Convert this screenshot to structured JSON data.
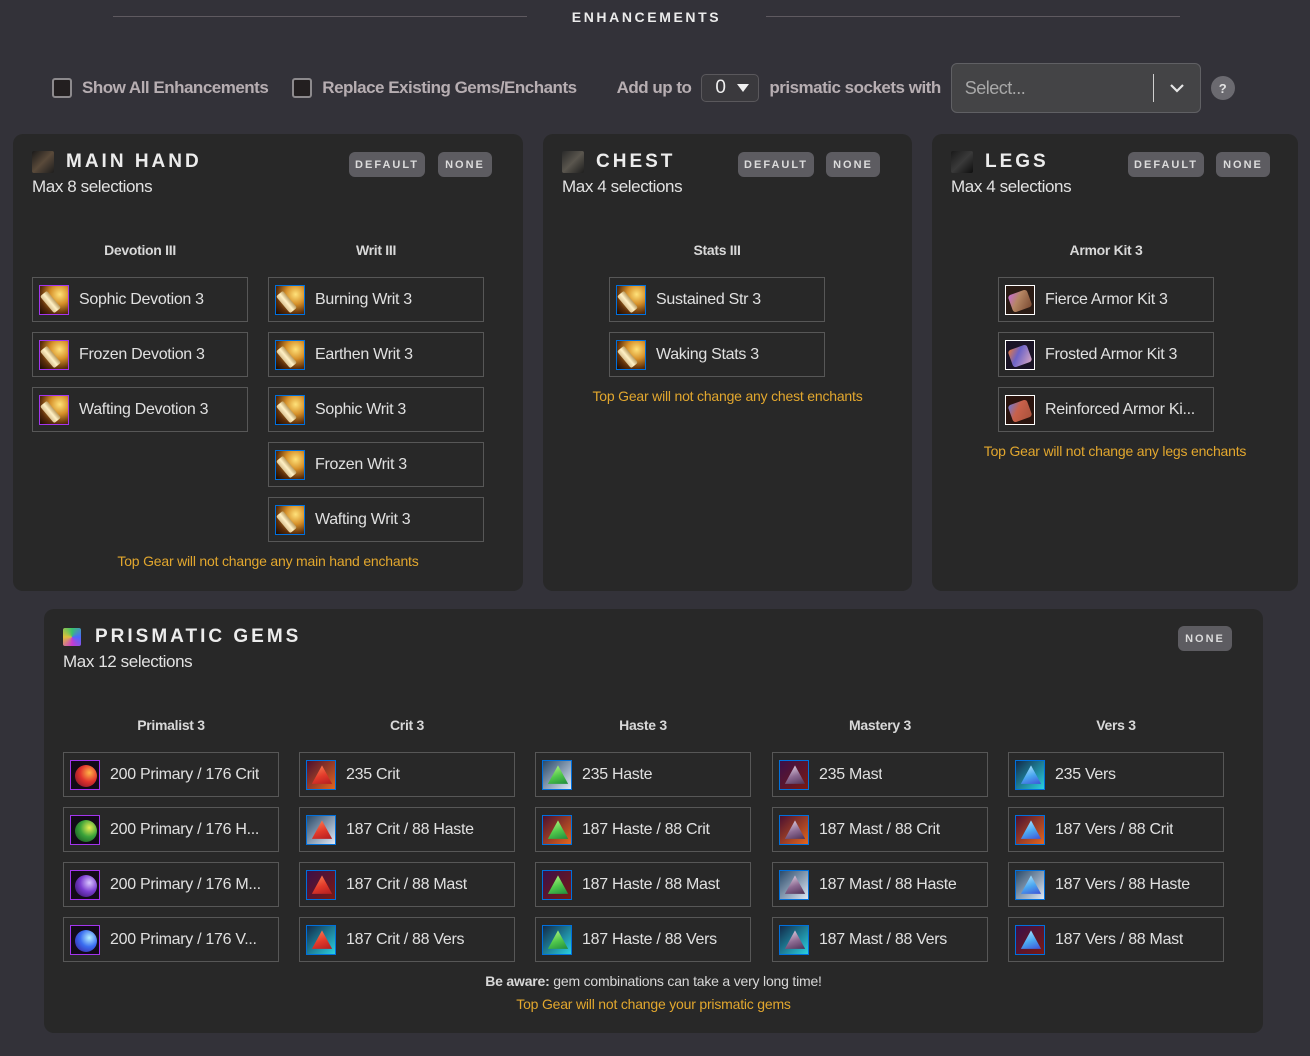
{
  "header": {
    "title": "ENHANCEMENTS"
  },
  "options": {
    "show_all_label": "Show All Enhancements",
    "show_all_checked": false,
    "replace_label": "Replace Existing Gems/Enchants",
    "replace_checked": false,
    "add_up_to_label": "Add up to",
    "socket_count": "0",
    "sockets_with_label": "prismatic sockets with",
    "gem_select_placeholder": "Select...",
    "help_label": "?"
  },
  "buttons": {
    "default": "DEFAULT",
    "none": "NONE"
  },
  "main_hand": {
    "title": "MAIN HAND",
    "subtitle": "Max 8 selections",
    "icon": "sword-icon",
    "columns": [
      {
        "header": "Devotion III",
        "items": [
          "Sophic Devotion 3",
          "Frozen Devotion 3",
          "Wafting Devotion 3"
        ]
      },
      {
        "header": "Writ III",
        "items": [
          "Burning Writ 3",
          "Earthen Writ 3",
          "Sophic Writ 3",
          "Frozen Writ 3",
          "Wafting Writ 3"
        ]
      }
    ],
    "note": "Top Gear will not change any main hand enchants"
  },
  "chest": {
    "title": "CHEST",
    "subtitle": "Max 4 selections",
    "icon": "chest-armor-icon",
    "columns": [
      {
        "header": "Stats III",
        "items": [
          "Sustained Str 3",
          "Waking Stats 3"
        ]
      }
    ],
    "note": "Top Gear will not change any chest enchants"
  },
  "legs": {
    "title": "LEGS",
    "subtitle": "Max 4 selections",
    "icon": "legs-armor-icon",
    "columns": [
      {
        "header": "Armor Kit 3",
        "items": [
          "Fierce Armor Kit 3",
          "Frosted Armor Kit 3",
          "Reinforced Armor Ki..."
        ]
      }
    ],
    "note": "Top Gear will not change any legs enchants"
  },
  "gems": {
    "title": "PRISMATIC GEMS",
    "subtitle": "Max 12 selections",
    "icon": "prismatic-gems-icon",
    "columns": [
      {
        "header": "Primalist 3",
        "items": [
          "200 Primary / 176 Crit",
          "200 Primary / 176 H...",
          "200 Primary / 176 M...",
          "200 Primary / 176 V..."
        ]
      },
      {
        "header": "Crit 3",
        "items": [
          "235 Crit",
          "187 Crit / 88 Haste",
          "187 Crit / 88 Mast",
          "187 Crit / 88 Vers"
        ]
      },
      {
        "header": "Haste 3",
        "items": [
          "235 Haste",
          "187 Haste / 88 Crit",
          "187 Haste / 88 Mast",
          "187 Haste / 88 Vers"
        ]
      },
      {
        "header": "Mastery 3",
        "items": [
          "235 Mast",
          "187 Mast / 88 Crit",
          "187 Mast / 88 Haste",
          "187 Mast / 88 Vers"
        ]
      },
      {
        "header": "Vers 3",
        "items": [
          "235 Vers",
          "187 Vers / 88 Crit",
          "187 Vers / 88 Haste",
          "187 Vers / 88 Mast"
        ]
      }
    ],
    "warning_bold": "Be aware:",
    "warning_text": " gem combinations can take a very long time!",
    "note": "Top Gear will not change your prismatic gems"
  },
  "colors": {
    "background": "#333239",
    "panel": "#282828",
    "note": "#e2a72e",
    "epic_border": "#a335ee",
    "rare_border": "#0070dd"
  }
}
